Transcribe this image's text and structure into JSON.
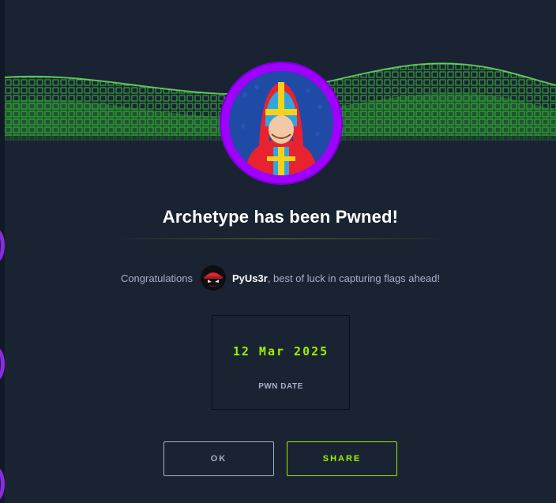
{
  "modal": {
    "title": "Archetype has been Pwned!",
    "congrats_prefix": "Congratulations",
    "username": "PyUs3r",
    "congrats_suffix": ", best of luck in capturing flags ahead!",
    "pwn_date": "12 Mar 2025",
    "pwn_date_label": "PWN DATE",
    "ok_label": "OK",
    "share_label": "SHARE"
  },
  "colors": {
    "accent": "#9fef00",
    "avatar_ring": "#9f00ff",
    "background": "#1a2332",
    "muted_text": "#a4b1cd"
  },
  "icons": {
    "machine_avatar": "hooded-hero-icon",
    "user_avatar": "red-hat-hacker-icon"
  }
}
